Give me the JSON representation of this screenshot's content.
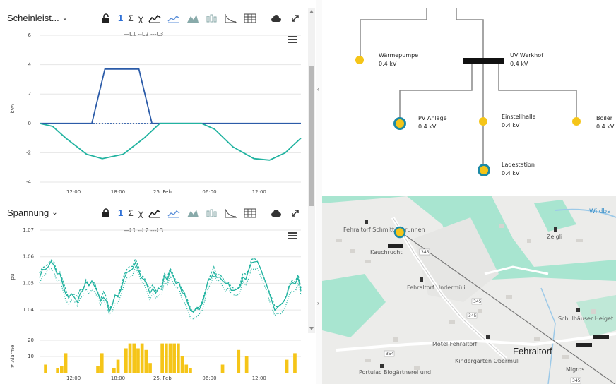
{
  "panels": [
    {
      "title": "Scheinleist...",
      "toolbar": {
        "count": "1",
        "sum": "Σ",
        "phase": "ꭓ"
      },
      "legend": "—L1 --L2 ---L3",
      "ylabel": "kVA"
    },
    {
      "title": "Spannung",
      "toolbar": {
        "count": "1",
        "sum": "Σ",
        "phase": "ꭓ"
      },
      "legend": "—L1 --L2 ---L3",
      "ylabel": "pu"
    }
  ],
  "chart_data": [
    {
      "type": "line",
      "ylabel": "kVA",
      "ylim": [
        -4,
        6
      ],
      "yticks": [
        "6",
        "4",
        "2",
        "0",
        "-2",
        "-4"
      ],
      "xticks": [
        "12:00",
        "18:00",
        "25. Feb",
        "06:00",
        "12:00"
      ],
      "grid": true,
      "series": [
        {
          "name": "L1",
          "color": "#2b5ba8",
          "points": [
            [
              0,
              0
            ],
            [
              0.2,
              0
            ],
            [
              0.25,
              3.7
            ],
            [
              0.38,
              3.7
            ],
            [
              0.43,
              0
            ],
            [
              1,
              0
            ]
          ]
        },
        {
          "name": "L2",
          "color": "#21b3a0",
          "points": [
            [
              0,
              0
            ],
            [
              0.05,
              -0.2
            ],
            [
              0.1,
              -1.0
            ],
            [
              0.18,
              -2.1
            ],
            [
              0.24,
              -2.4
            ],
            [
              0.32,
              -2.1
            ],
            [
              0.4,
              -1.0
            ],
            [
              0.46,
              0
            ],
            [
              0.62,
              0
            ],
            [
              0.67,
              -0.4
            ],
            [
              0.74,
              -1.6
            ],
            [
              0.82,
              -2.4
            ],
            [
              0.88,
              -2.5
            ],
            [
              0.94,
              -2.0
            ],
            [
              1,
              -1.0
            ]
          ]
        }
      ]
    },
    {
      "type": "line",
      "ylabel": "pu",
      "ylim": [
        1.035,
        1.07
      ],
      "yticks": [
        "1.07",
        "1.06",
        "1.05",
        "1.04"
      ],
      "xticks": [
        "12:00",
        "18:00",
        "25. Feb",
        "06:00",
        "12:00"
      ],
      "grid": true,
      "series": [
        {
          "name": "L1",
          "color": "#21b3a0"
        },
        {
          "name": "L2",
          "color": "#21b3a0"
        },
        {
          "name": "L3",
          "color": "#21b3a0"
        }
      ]
    },
    {
      "type": "bar",
      "ylabel": "# Alarme",
      "ylim": [
        0,
        20
      ],
      "yticks": [
        "20",
        "10"
      ],
      "xticks": [
        "12:00",
        "18:00",
        "25. Feb",
        "06:00",
        "12:00"
      ],
      "color": "#f5c518",
      "values": [
        0,
        5,
        0,
        0,
        3,
        4,
        12,
        0,
        0,
        0,
        0,
        0,
        0,
        0,
        4,
        12,
        0,
        0,
        3,
        8,
        0,
        15,
        18,
        18,
        15,
        18,
        14,
        6,
        0,
        0,
        18,
        18,
        18,
        18,
        18,
        10,
        5,
        3,
        0,
        0,
        0,
        0,
        0,
        0,
        0,
        5,
        0,
        0,
        0,
        14,
        0,
        10,
        0,
        0,
        0,
        0,
        0,
        0,
        0,
        0,
        0,
        8,
        0,
        12,
        0
      ]
    }
  ],
  "network": {
    "nodes": [
      {
        "name": "Wärmepumpe",
        "voltage": "0.4 kV"
      },
      {
        "name": "UV Werkhof",
        "voltage": "0.4 kV"
      },
      {
        "name": "PV Anlage",
        "voltage": "0.4 kV"
      },
      {
        "name": "Einstellhalle",
        "voltage": "0.4 kV"
      },
      {
        "name": "Boiler",
        "voltage": "0.4 kV"
      },
      {
        "name": "Ladestation",
        "voltage": "0.4 kV"
      }
    ]
  },
  "map": {
    "town": "Fehraltorf",
    "places": [
      "Fehraltorf Schmittenbrunnen",
      "Kauchrucht",
      "Fehraltorf Undermüli",
      "Motel Fehraltorf",
      "Kindergarten Obermüli",
      "Portulac Biogärtnerei und",
      "Schulhäuser Heiget",
      "Migros",
      "Zelgli",
      "Wildba"
    ],
    "roads": [
      "345",
      "345",
      "345",
      "354",
      "345"
    ]
  },
  "colors": {
    "accent": "#2c6fd6",
    "teal": "#21b3a0",
    "yellow": "#f5c518",
    "map_green": "#a8e5d0"
  }
}
